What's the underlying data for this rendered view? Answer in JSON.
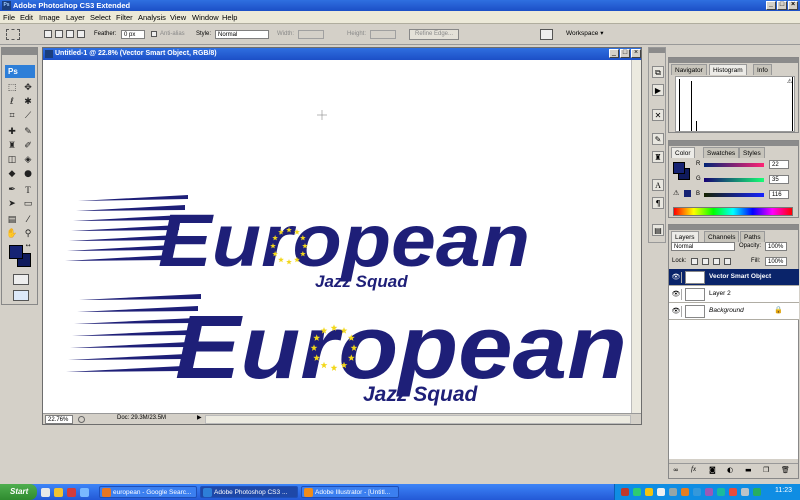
{
  "window": {
    "title": "Adobe Photoshop CS3 Extended",
    "app_icon": "Ps"
  },
  "menu": [
    "File",
    "Edit",
    "Image",
    "Layer",
    "Select",
    "Filter",
    "Analysis",
    "View",
    "Window",
    "Help"
  ],
  "options_bar": {
    "feather_label": "Feather:",
    "feather_value": "0 px",
    "antialias_label": "Anti-alias",
    "style_label": "Style:",
    "style_value": "Normal",
    "width_label": "Width:",
    "height_label": "Height:",
    "refine_edge": "Refine Edge...",
    "workspace": "Workspace ▾"
  },
  "toolbox": {
    "logo": "Ps"
  },
  "document": {
    "title": "Untitled-1 @ 22.8% (Vector Smart Object, RGB/8)",
    "logo_text": "European",
    "tagline": "Jazz Squad",
    "zoom": "22.76%",
    "doc_info": "Doc: 29.3M/23.5M"
  },
  "panels": {
    "navigator_tabs": [
      "Navigator",
      "Histogram",
      "Info"
    ],
    "color_tabs": [
      "Color",
      "Swatches",
      "Styles"
    ],
    "color": {
      "r_label": "R",
      "r_value": "22",
      "g_label": "G",
      "g_value": "35",
      "b_label": "B",
      "b_value": "116",
      "swatch_color": "#162374"
    },
    "layers_tabs": [
      "Layers",
      "Channels",
      "Paths"
    ],
    "layers": {
      "blend_mode": "Normal",
      "opacity_label": "Opacity:",
      "opacity": "100%",
      "lock_label": "Lock:",
      "fill_label": "Fill:",
      "fill": "100%",
      "items": [
        "Vector Smart Object",
        "Layer 2",
        "Background"
      ]
    }
  },
  "taskbar": {
    "start": "Start",
    "items": [
      "european - Google Searc...",
      "Adobe Photoshop CS3 ...",
      "Adobe Illustrator - [Untitl..."
    ],
    "clock": "11:23"
  },
  "colors": {
    "logo_blue": "#1e1f78",
    "eu_yellow": "#f2d71b",
    "accent": "#2f6fe0"
  }
}
